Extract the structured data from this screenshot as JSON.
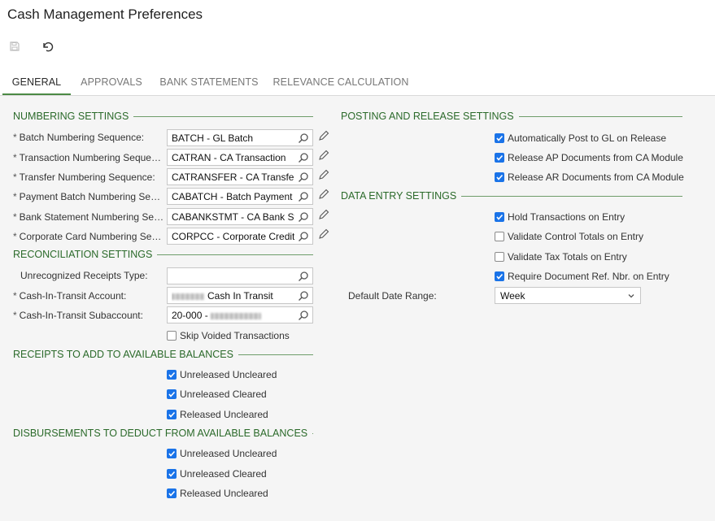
{
  "title": "Cash Management Preferences",
  "tabs": [
    {
      "label": "GENERAL",
      "active": true
    },
    {
      "label": "APPROVALS"
    },
    {
      "label": "BANK STATEMENTS"
    },
    {
      "label": "RELEVANCE CALCULATION"
    }
  ],
  "numbering": {
    "heading": "NUMBERING SETTINGS",
    "rows": [
      {
        "label": "Batch Numbering Sequence:",
        "value": "BATCH - GL Batch",
        "required": true
      },
      {
        "label": "Transaction Numbering Sequence:",
        "value": "CATRAN - CA Transaction",
        "required": true
      },
      {
        "label": "Transfer Numbering Sequence:",
        "value": "CATRANSFER - CA Transfer",
        "required": true
      },
      {
        "label": "Payment Batch Numbering Sequence:",
        "value": "CABATCH - Batch Payment Number",
        "required": true
      },
      {
        "label": "Bank Statement Numbering Sequence:",
        "value": "CABANKSTMT - CA Bank Statement",
        "required": true
      },
      {
        "label": "Corporate Card Numbering Sequence:",
        "value": "CORPCC - Corporate Credit Card",
        "required": true
      }
    ]
  },
  "reconciliation": {
    "heading": "RECONCILIATION SETTINGS",
    "unrecognized_label": "Unrecognized Receipts Type:",
    "unrecognized_value": "",
    "cit_account_label": "Cash-In-Transit Account:",
    "cit_account_value": "Cash In Transit",
    "cit_sub_label": "Cash-In-Transit Subaccount:",
    "cit_sub_value": "20-000 -",
    "skip_voided_label": "Skip Voided Transactions",
    "skip_voided": false
  },
  "receipts": {
    "heading": "RECEIPTS TO ADD TO AVAILABLE BALANCES",
    "items": [
      {
        "label": "Unreleased Uncleared",
        "checked": true
      },
      {
        "label": "Unreleased Cleared",
        "checked": true
      },
      {
        "label": "Released Uncleared",
        "checked": true
      }
    ]
  },
  "disbursements": {
    "heading": "DISBURSEMENTS TO DEDUCT FROM AVAILABLE BALANCES",
    "items": [
      {
        "label": "Unreleased Uncleared",
        "checked": true
      },
      {
        "label": "Unreleased Cleared",
        "checked": true
      },
      {
        "label": "Released Uncleared",
        "checked": true
      }
    ]
  },
  "posting": {
    "heading": "POSTING AND RELEASE SETTINGS",
    "items": [
      {
        "label": "Automatically Post to GL on Release",
        "checked": true
      },
      {
        "label": "Release AP Documents from CA Module",
        "checked": true
      },
      {
        "label": "Release AR Documents from CA Module",
        "checked": true
      }
    ]
  },
  "data_entry": {
    "heading": "DATA ENTRY SETTINGS",
    "items": [
      {
        "label": "Hold Transactions on Entry",
        "checked": true
      },
      {
        "label": "Validate Control Totals on Entry",
        "checked": false
      },
      {
        "label": "Validate Tax Totals on Entry",
        "checked": false
      },
      {
        "label": "Require Document Ref. Nbr. on Entry",
        "checked": true
      }
    ],
    "date_range_label": "Default Date Range:",
    "date_range_value": "Week"
  },
  "colors": {
    "accent": "#4c8a45",
    "checkbox": "#1a73e8",
    "section": "#2b6a2a"
  }
}
